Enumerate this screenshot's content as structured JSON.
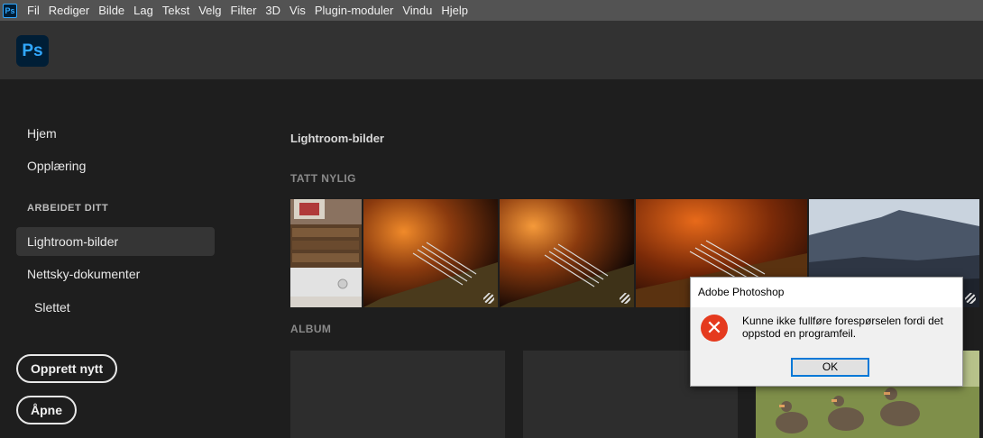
{
  "menubar": {
    "app_icon": "Ps",
    "items": [
      "Fil",
      "Rediger",
      "Bilde",
      "Lag",
      "Tekst",
      "Velg",
      "Filter",
      "3D",
      "Vis",
      "Plugin-moduler",
      "Vindu",
      "Hjelp"
    ]
  },
  "header": {
    "logo": "Ps"
  },
  "sidebar": {
    "home": "Hjem",
    "learn": "Opplæring",
    "your_work_heading": "ARBEIDET DITT",
    "lightroom": "Lightroom-bilder",
    "cloud_docs": "Nettsky-dokumenter",
    "deleted": "Slettet",
    "create_new": "Opprett nytt",
    "open": "Åpne"
  },
  "main": {
    "section_title": "Lightroom-bilder",
    "recent_heading": "TATT NYLIG",
    "album_heading": "ALBUM"
  },
  "dialog": {
    "title": "Adobe Photoshop",
    "message": "Kunne ikke fullføre forespørselen fordi det oppstod en programfeil.",
    "ok": "OK",
    "error_icon": "error-x-icon"
  },
  "colors": {
    "menubar": "#535353",
    "header": "#323232",
    "background": "#1e1e1e",
    "ps_blue": "#31a8ff",
    "error_red": "#e53a1e",
    "focus_blue": "#0078d7"
  }
}
